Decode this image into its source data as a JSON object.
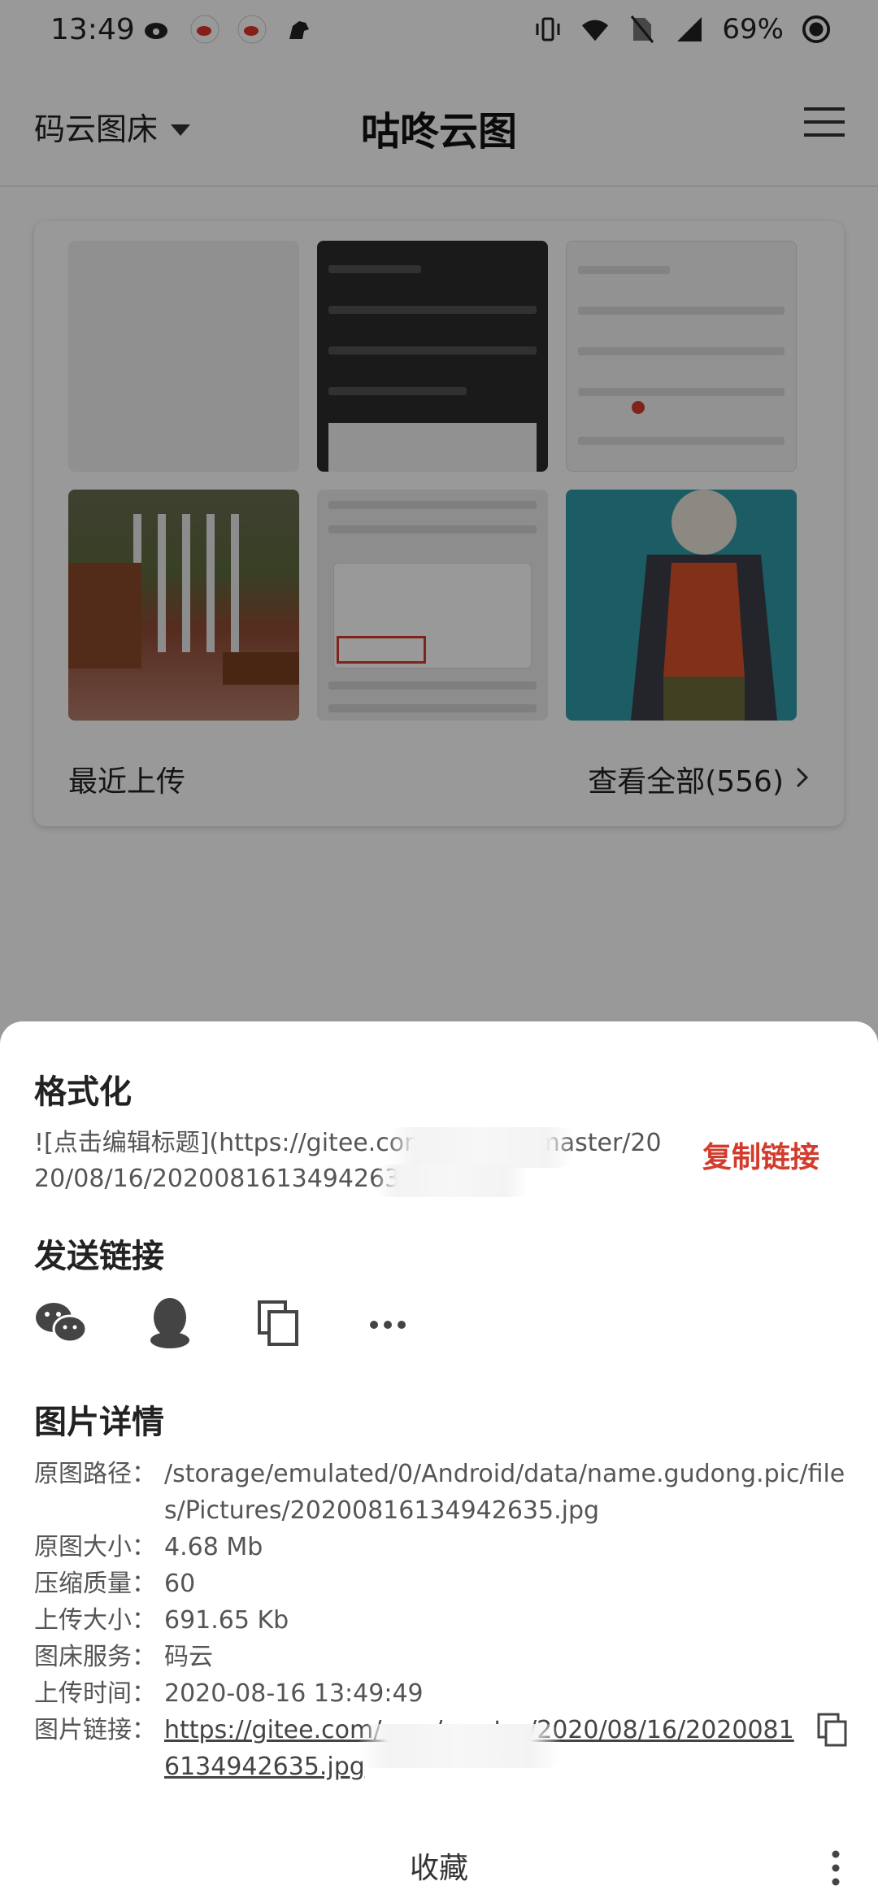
{
  "status_bar": {
    "time": "13:49",
    "battery": "69%",
    "left_icons": [
      "weibo-icon",
      "weibo-badge-icon",
      "weibo-badge-icon",
      "horse-icon"
    ],
    "right_icons": [
      "vibrate-icon",
      "wifi-icon",
      "no-sim-icon",
      "signal-icon",
      "battery-ring-icon"
    ]
  },
  "app_bar": {
    "bed_selector": "码云图床",
    "title": "咕咚云图",
    "menu_icon": "hamburger-icon"
  },
  "recent": {
    "label": "最近上传",
    "view_all": "查看全部(556)"
  },
  "sheet": {
    "format_title": "格式化",
    "format_text": "![点击编辑标题](https://gitee.com/                     ng/raw/master/2020/08/16/20200816134942635.jpg)",
    "copy_link": "复制链接",
    "share_title": "发送链接",
    "share_icons": [
      "wechat-icon",
      "qq-icon",
      "copy-icon",
      "more-horizontal-icon"
    ],
    "details_title": "图片详情",
    "details": {
      "path_key": "原图路径：",
      "path_val": "/storage/emulated/0/Android/data/name.gudong.pic/files/Pictures/20200816134942635.jpg",
      "size_key": "原图大小：",
      "size_val": "4.68 Mb",
      "quality_key": "压缩质量：",
      "quality_val": "60",
      "upload_size_key": "上传大小：",
      "upload_size_val": "691.65 Kb",
      "service_key": "图床服务：",
      "service_val": "码云",
      "time_key": "上传时间：",
      "time_val": "2020-08-16 13:49:49",
      "link_key": "图片链接：",
      "link_val": "https://gitee.com/                          raw/master/2020/08/16/20200816134942635.jpg"
    },
    "favorite": "收藏"
  },
  "colors": {
    "accent_red": "#d23c2c",
    "dim_overlay": "rgba(0,0,0,0.40)"
  }
}
